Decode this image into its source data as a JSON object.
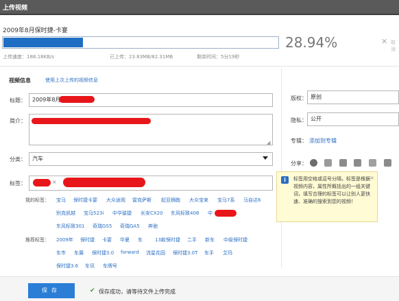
{
  "window": {
    "title": "上传视频"
  },
  "upload": {
    "file_title": "2009年8月保时捷-卡宴",
    "progress_percent": 28.94,
    "percent_text": "28.94%",
    "cancel_text": "取消",
    "speed": "上传速度：188.18KB/s",
    "uploaded": "已上传：23.83MB/82.31MB",
    "remaining": "剩余时间：5分19秒"
  },
  "form": {
    "section_title": "视频信息",
    "reuse_link": "使用上次上传的视频信息",
    "title_label": "标题：",
    "title_value": "2009年8月",
    "intro_label": "简介：",
    "intro_value": "",
    "category_label": "分类：",
    "category_value": "汽车",
    "tags_label": "标签：",
    "my_tags_label": "我的标签：",
    "my_tags": [
      "宝马",
      "保时捷卡宴",
      "大众途观",
      "雷克萨斯",
      "起亚狮跑",
      "大众宝来",
      "宝马7系",
      "马自达6",
      "别克凯越",
      "宝马523i",
      "中华骏捷",
      "长安CX20",
      "东风标致408",
      "中",
      "东风标致301",
      "奇瑞GS5",
      "奇瑞GA5",
      "奔驰"
    ],
    "rec_tags_label": "推荐标签：",
    "rec_tags": [
      "2009年",
      "保时捷",
      "卡宴",
      "华夏",
      "车",
      "13款保时捷",
      "二手",
      "新车",
      "中级保时捷",
      "车市",
      "车展",
      "保时捷3.0",
      "forward",
      "流星花园",
      "保时捷3.0T",
      "车手",
      "艾玛",
      "保时捷3.6",
      "车讯",
      "车牌号"
    ]
  },
  "side": {
    "copyright_label": "版权：",
    "copyright_value": "原创",
    "privacy_label": "隐私：",
    "privacy_value": "公开",
    "album_label": "专辑：",
    "album_link": "添加到专辑",
    "share_label": "分享："
  },
  "tooltip": {
    "icon": "i",
    "text": "标签用空格或逗号分隔，标签是根据视频内容，属性所概括出的一组关键词，填写合理的标签可以让别人更快速、准确的搜索到您的视频！",
    "close": "×"
  },
  "footer": {
    "save_label": "保存",
    "success_text": "保存成功，请等待文件上传完成"
  }
}
